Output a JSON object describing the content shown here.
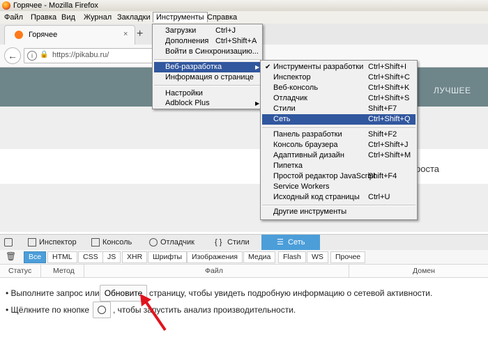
{
  "window": {
    "title": "Горячее - Mozilla Firefox"
  },
  "menubar": [
    "Файл",
    "Правка",
    "Вид",
    "Журнал",
    "Закладки",
    "Инструменты",
    "Справка"
  ],
  "tab": {
    "title": "Горячее",
    "close": "×",
    "new_tab": "+"
  },
  "navbar": {
    "back": "←",
    "url": "https://pikabu.ru/"
  },
  "page": {
    "nav_best": "ЛУЧШЕЕ",
    "card_text": "роста"
  },
  "tools_menu": {
    "items": [
      {
        "label": "Загрузки",
        "accel": "Ctrl+J"
      },
      {
        "label": "Дополнения",
        "accel": "Ctrl+Shift+A"
      },
      {
        "label": "Войти в Синхронизацию...",
        "accel": ""
      },
      {
        "label": "Веб-разработка",
        "accel": "",
        "submenu": true
      },
      {
        "label": "Информация о странице",
        "accel": ""
      },
      {
        "label": "Настройки",
        "accel": ""
      },
      {
        "label": "Adblock Plus",
        "accel": "",
        "submenu": true
      }
    ]
  },
  "webdev_menu": {
    "items": [
      {
        "label": "Инструменты разработки",
        "accel": "Ctrl+Shift+I",
        "checked": true
      },
      {
        "label": "Инспектор",
        "accel": "Ctrl+Shift+C"
      },
      {
        "label": "Веб-консоль",
        "accel": "Ctrl+Shift+K"
      },
      {
        "label": "Отладчик",
        "accel": "Ctrl+Shift+S"
      },
      {
        "label": "Стили",
        "accel": "Shift+F7"
      },
      {
        "label": "Сеть",
        "accel": "Ctrl+Shift+Q"
      },
      {
        "label": "Панель разработки",
        "accel": "Shift+F2"
      },
      {
        "label": "Консоль браузера",
        "accel": "Ctrl+Shift+J"
      },
      {
        "label": "Адаптивный дизайн",
        "accel": "Ctrl+Shift+M"
      },
      {
        "label": "Пипетка",
        "accel": ""
      },
      {
        "label": "Простой редактор JavaScript",
        "accel": "Shift+F4"
      },
      {
        "label": "Service Workers",
        "accel": ""
      },
      {
        "label": "Исходный код страницы",
        "accel": "Ctrl+U"
      },
      {
        "label": "Другие инструменты",
        "accel": ""
      }
    ]
  },
  "devtools": {
    "tabs": [
      "Инспектор",
      "Консоль",
      "Отладчик",
      "Стили",
      "Сеть"
    ],
    "filters": [
      "Все",
      "HTML",
      "CSS",
      "JS",
      "XHR",
      "Шрифты",
      "Изображения",
      "Медиа",
      "Flash",
      "WS",
      "Прочее"
    ],
    "columns": [
      "Статус",
      "Метод",
      "Файл",
      "Домен"
    ],
    "hint1_pre": "• Выполните запрос или",
    "reload_button": "Обновите",
    "hint1_post": "страницу, чтобы увидеть подробную информацию о сетевой активности.",
    "hint2_pre": "• Щёлкните по кнопке",
    "hint2_post": ", чтобы запустить анализ производительности."
  },
  "colors": {
    "highlight": "#31579e",
    "devtools_active": "#4c9ed9",
    "page_header": "#6e858a",
    "annotation_arrow": "#e0141e"
  }
}
